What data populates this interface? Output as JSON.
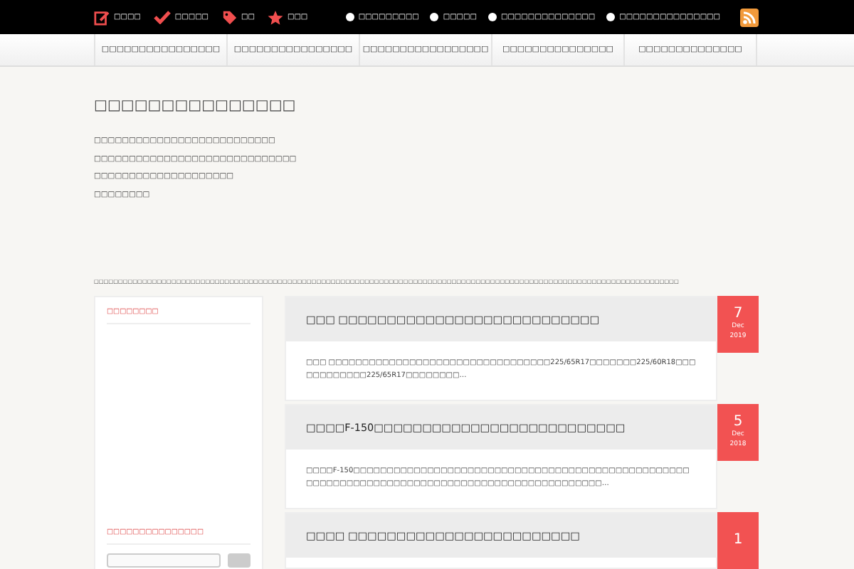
{
  "top_bar": {
    "left_links": [
      {
        "kind": "edit",
        "label": "□□□□"
      },
      {
        "kind": "check",
        "label": "□□□□□"
      },
      {
        "kind": "tag",
        "label": "□□"
      },
      {
        "kind": "star",
        "label": "□□□"
      }
    ],
    "right_links": [
      "□□□□□□□□□",
      "□□□□□",
      "□□□□□□□□□□□□□□",
      "□□□□□□□□□□□□□□□"
    ]
  },
  "nav": [
    "□□□□□□□□□□□□□□□□",
    "□□□□□□□□□□□□□□□□",
    "□□□□□□□□□□□□□□□□□",
    "□□□□□□□□□□□□□□□",
    "□□□□□□□□□□□□□□"
  ],
  "site": {
    "title": "□□□□□□□□□□□□□□□",
    "description": [
      "□□□□□□□□□□□□□□□□□□□□□□□□□□",
      "□□□□□□□□□□□□□□□□□□□□□□□□□□□□□",
      "□□□□□□□□□□□□□□□□□□□□",
      "□□□□□□□□"
    ],
    "notice": "□□□□□□□□□□□□□□□□□□□□□□□□□□□□□□□□□□□□□□□□□□□□□□□□□□□□□□□□□□□□□□□□□□□□□□□□□□□□□□□□□□□□□□□□□□□□□□□□□□□□□□□□□□□□□□□□□□□□□□□□□"
  },
  "sidebar": {
    "widgets": [
      {
        "title": "□□□□□□□□"
      },
      {
        "title": "□□□□□□□□□□□□□□□"
      }
    ]
  },
  "posts": [
    {
      "title": "□□□ □□□□□□□□□□□□□□□□□□□□□□□□□□□",
      "excerpt": "□□□ □□□□□□□□□□□□□□□□□□□□□□□□□□□□□□□□□225/65R17□□□□□□□225/60R18□□□□□□□□□□□□225/65R17□□□□□□□□…",
      "day": "7",
      "month": "Dec",
      "year": "2019"
    },
    {
      "title": "□□□□F-150□□□□□□□□□□□□□□□□□□□□□□□□□□",
      "excerpt": "□□□□F-150□□□□□□□□□□□□□□□□□□□□□□□□□□□□□□□□□□□□□□□□□□□□□□□□□□□□□□□□□□□□□□□□□□□□□□□□□□□□□□□□□□□□□□□□□□□□□□…",
      "day": "5",
      "month": "Dec",
      "year": "2018"
    },
    {
      "title": "□□□□ □□□□□□□□□□□□□□□□□□□□□□□□",
      "day": "1"
    }
  ]
}
